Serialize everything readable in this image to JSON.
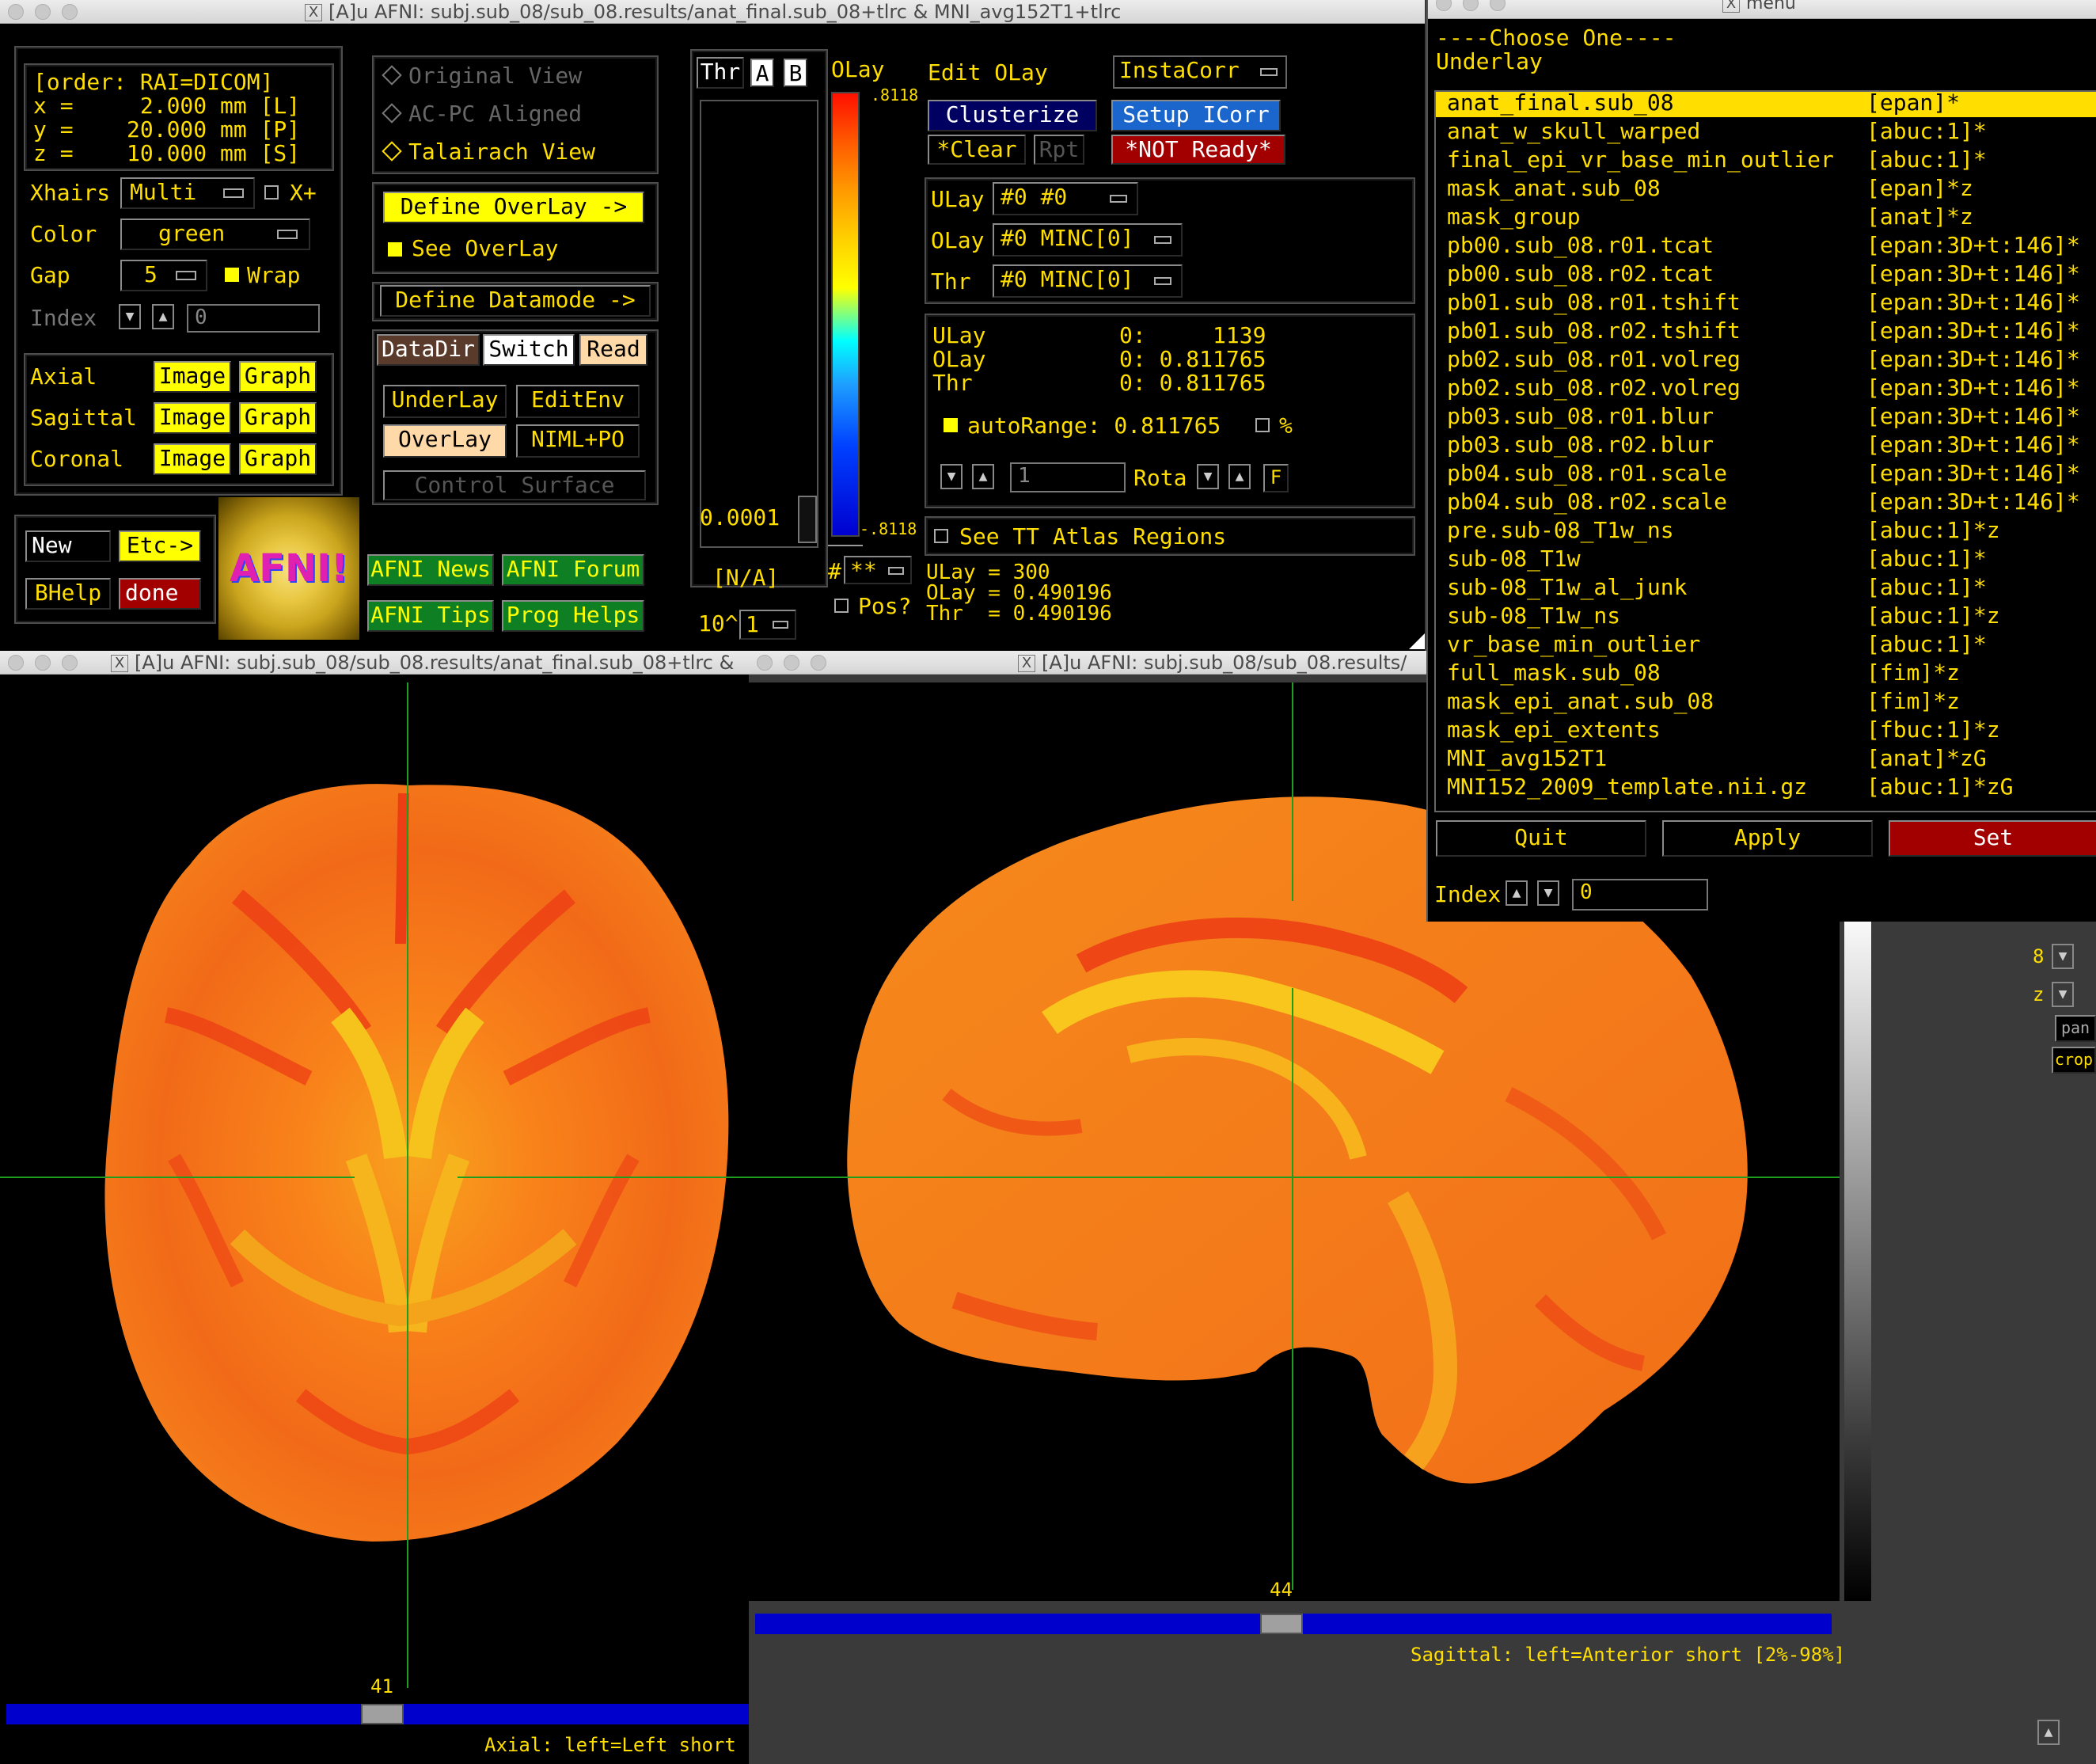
{
  "main_window": {
    "title": "[A]u AFNI: subj.sub_08/sub_08.results/anat_final.sub_08+tlrc & MNI_avg152T1+tlrc",
    "coords": {
      "order": "[order: RAI=DICOM]",
      "x_row": "x =     2.000 mm [L]",
      "y_row": "y =    20.000 mm [P]",
      "z_row": "z =    10.000 mm [S]"
    },
    "xhairs_label": "Xhairs",
    "xhairs_value": "Multi",
    "xplus_label": "X+",
    "color_label": "Color",
    "color_value": "green",
    "gap_label": "Gap",
    "gap_value": "5",
    "wrap_label": "Wrap",
    "index_label": "Index",
    "index_value": "0",
    "views": [
      {
        "label": "Axial",
        "image": "Image",
        "graph": "Graph"
      },
      {
        "label": "Sagittal",
        "image": "Image",
        "graph": "Graph"
      },
      {
        "label": "Coronal",
        "image": "Image",
        "graph": "Graph"
      }
    ],
    "new_label": "New",
    "etc_label": "Etc->",
    "bhelp_label": "BHelp",
    "done_label": "done",
    "logo_text": "AFNI!",
    "view_modes": [
      "Original View",
      "AC-PC Aligned",
      "Talairach View"
    ],
    "define_overlay": "Define OverLay ->",
    "see_overlay": "See OverLay",
    "define_datamode": "Define Datamode ->",
    "datadir": "DataDir",
    "switch": "Switch",
    "read": "Read",
    "underlay_btn": "UnderLay",
    "editenv_btn": "EditEnv",
    "overlay_btn": "OverLay",
    "niml_btn": "NIML+PO",
    "control_surface": "Control Surface",
    "news": "AFNI News",
    "forum": "AFNI Forum",
    "tips": "AFNI Tips",
    "prog_helps": "Prog Helps",
    "thr_label": "Thr",
    "a_label": "A",
    "b_label": "B",
    "thr_value": "0.0001",
    "na_label": "[N/A]",
    "pow_label": "10^",
    "pow_value": "1",
    "olay_label": "OLay",
    "olay_top": ".8118",
    "olay_bottom": "-.8118",
    "hash_label": "#",
    "stars_value": "**",
    "pos_label": "Pos?",
    "edit_olay": "Edit OLay",
    "instacorr": "InstaCorr",
    "clusterize": "Clusterize",
    "setup_icorr": "Setup ICorr",
    "clear": "*Clear",
    "rpt": "Rpt",
    "not_ready": "*NOT Ready*",
    "ulay_sel_label": "ULay",
    "ulay_sel_value": "#0 #0",
    "olay_sel_label": "OLay",
    "olay_sel_value": "#0 MINC[0]",
    "thr_sel_label": "Thr",
    "thr_sel_value": "#0 MINC[0]",
    "info": {
      "ulay": "ULay          0:     1139",
      "olay": "OLay          0: 0.811765",
      "thr": "Thr           0: 0.811765"
    },
    "autorange": "autoRange: 0.811765",
    "percent": "%",
    "rota_field": "1",
    "rota_label": "Rota",
    "f_label": "F",
    "tt_atlas": "See TT Atlas Regions",
    "bottom_vals": {
      "ulay": "ULay = 300",
      "olay": "OLay = 0.490196",
      "thr": "Thr  = 0.490196"
    }
  },
  "axial_window": {
    "title": "[A]u AFNI: subj.sub_08/sub_08.results/anat_final.sub_08+tlrc &",
    "slice_number": "41",
    "status": "Axial: left=Left short ["
  },
  "sagittal_window": {
    "title": "[A]u AFNI: subj.sub_08/sub_08.results/",
    "slice_number": "44",
    "status": "Sagittal: left=Anterior short [2%-98%]",
    "side_labels": [
      "8",
      "z"
    ],
    "side_buttons": [
      "pan",
      "crop"
    ]
  },
  "menu_window": {
    "title": "menu",
    "header1": "----Choose One----",
    "header2": "Underlay",
    "items": [
      {
        "name": "anat_final.sub_08",
        "type": "[epan]*"
      },
      {
        "name": "anat_w_skull_warped",
        "type": "[abuc:1]*"
      },
      {
        "name": "final_epi_vr_base_min_outlier",
        "type": "[abuc:1]*"
      },
      {
        "name": "mask_anat.sub_08",
        "type": "[epan]*z"
      },
      {
        "name": "mask_group",
        "type": "[anat]*z"
      },
      {
        "name": "pb00.sub_08.r01.tcat",
        "type": "[epan:3D+t:146]*"
      },
      {
        "name": "pb00.sub_08.r02.tcat",
        "type": "[epan:3D+t:146]*"
      },
      {
        "name": "pb01.sub_08.r01.tshift",
        "type": "[epan:3D+t:146]*"
      },
      {
        "name": "pb01.sub_08.r02.tshift",
        "type": "[epan:3D+t:146]*"
      },
      {
        "name": "pb02.sub_08.r01.volreg",
        "type": "[epan:3D+t:146]*"
      },
      {
        "name": "pb02.sub_08.r02.volreg",
        "type": "[epan:3D+t:146]*"
      },
      {
        "name": "pb03.sub_08.r01.blur",
        "type": "[epan:3D+t:146]*"
      },
      {
        "name": "pb03.sub_08.r02.blur",
        "type": "[epan:3D+t:146]*"
      },
      {
        "name": "pb04.sub_08.r01.scale",
        "type": "[epan:3D+t:146]*"
      },
      {
        "name": "pb04.sub_08.r02.scale",
        "type": "[epan:3D+t:146]*"
      },
      {
        "name": "pre.sub-08_T1w_ns",
        "type": "[abuc:1]*z"
      },
      {
        "name": "sub-08_T1w",
        "type": "[abuc:1]*"
      },
      {
        "name": "sub-08_T1w_al_junk",
        "type": "[abuc:1]*"
      },
      {
        "name": "sub-08_T1w_ns",
        "type": "[abuc:1]*z"
      },
      {
        "name": "vr_base_min_outlier",
        "type": "[abuc:1]*"
      },
      {
        "name": "full_mask.sub_08",
        "type": "[fim]*z"
      },
      {
        "name": "mask_epi_anat.sub_08",
        "type": "[fim]*z"
      },
      {
        "name": "mask_epi_extents",
        "type": "[fbuc:1]*z"
      },
      {
        "name": "MNI_avg152T1",
        "type": "[anat]*zG"
      },
      {
        "name": "MNI152_2009_template.nii.gz",
        "type": "[abuc:1]*zG"
      }
    ],
    "selected_index": 0,
    "quit": "Quit",
    "apply": "Apply",
    "set": "Set",
    "index_label": "Index",
    "index_value": "0"
  },
  "colors": {
    "label_yellow": "#ffde00",
    "button_yellow": "#ffff00",
    "button_green": "#11a018",
    "done_red": "#a20000",
    "crosshair": "#1e9e1e",
    "slider_blue": "#0000cc",
    "brain_orange": "#ff8a1c",
    "brain_red": "#ee3d12"
  }
}
